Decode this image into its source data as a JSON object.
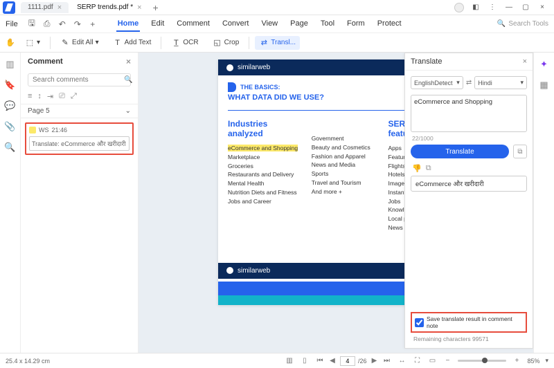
{
  "tabs": {
    "inactive": "1111.pdf",
    "active": "SERP trends.pdf *"
  },
  "file_menu": "File",
  "menus": {
    "home": "Home",
    "edit": "Edit",
    "comment": "Comment",
    "convert": "Convert",
    "view": "View",
    "page": "Page",
    "tool": "Tool",
    "form": "Form",
    "protect": "Protect"
  },
  "search_tools": "Search Tools",
  "toolbar": {
    "editall": "Edit All",
    "addtext": "Add Text",
    "ocr": "OCR",
    "crop": "Crop",
    "translate": "Transl..."
  },
  "comment_panel": {
    "title": "Comment",
    "search_ph": "Search comments",
    "page_label": "Page 5",
    "item_user": "WS",
    "item_time": "21:46",
    "item_text": "Translate: eCommerce और खरीदारी"
  },
  "doc": {
    "brand": "similarweb",
    "basics_l1": "THE BASICS:",
    "basics_l2": "WHAT DATA DID WE USE?",
    "col1_h": "Industries analyzed",
    "col1": [
      "eCommerce and Shopping",
      "Marketplace",
      "Groceries",
      "Restaurants and Delivery",
      "Mental Health",
      "Nutrition Diets and Fitness",
      "Jobs and Career"
    ],
    "col2": [
      "Government",
      "Beauty and Cosmetics",
      "Fashion and Apparel",
      "News and Media",
      "Sports",
      "Travel and Tourism",
      "And more +"
    ],
    "col3_h": "SERP features",
    "col3": [
      "Apps",
      "Featured",
      "Flights",
      "Hotels",
      "Images",
      "Instant answers",
      "Jobs",
      "Knowledge",
      "Local pack",
      "News"
    ]
  },
  "translate": {
    "title": "Translate",
    "src": "EnglishDetect",
    "dst": "Hindi",
    "input": "eCommerce and Shopping",
    "count": "22/1000",
    "btn": "Translate",
    "output": "eCommerce और खरीदारी",
    "save": "Save translate result in comment note",
    "remain": "Remaining characters 99571"
  },
  "status": {
    "dim": "25.4 x 14.29 cm",
    "page_cur": "4",
    "page_total": "/26",
    "zoom": "85%"
  }
}
